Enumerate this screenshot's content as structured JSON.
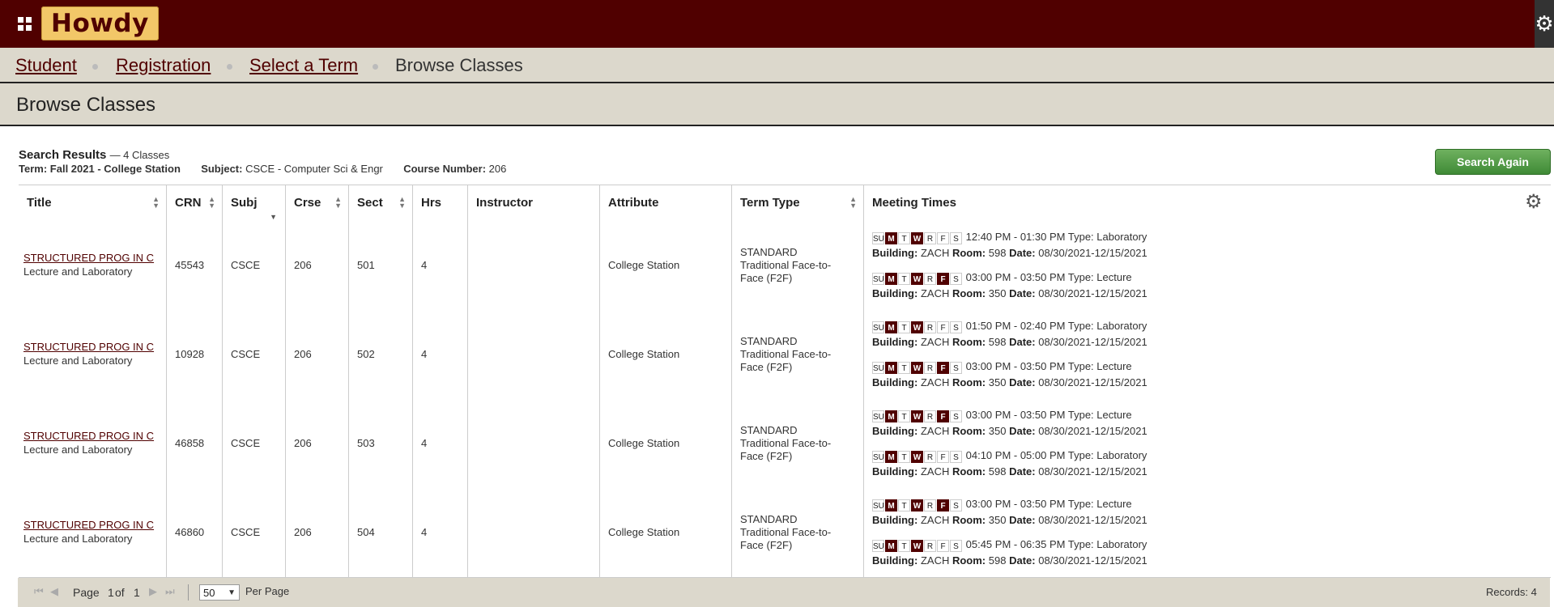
{
  "header": {
    "logo": "Howdy",
    "apps_icon": "apps-grid-icon",
    "settings_icon": "gear-icon"
  },
  "breadcrumb": [
    "Student",
    "Registration",
    "Select a Term",
    "Browse Classes"
  ],
  "page_title": "Browse Classes",
  "search": {
    "label": "Search Results",
    "count": "— 4 Classes",
    "term_label": "Term:",
    "term_value": "Fall 2021 - College Station",
    "subject_label": "Subject:",
    "subject_value": "CSCE - Computer Sci & Engr",
    "course_label": "Course Number:",
    "course_value": "206",
    "search_again": "Search Again"
  },
  "columns": [
    "Title",
    "CRN",
    "Subj",
    "Crse",
    "Sect",
    "Hrs",
    "Instructor",
    "Attribute",
    "Term Type",
    "Meeting Times"
  ],
  "rows": [
    {
      "title": "STRUCTURED PROG IN C",
      "subtitle": "Lecture and Laboratory",
      "crn": "45543",
      "subj": "CSCE",
      "crse": "206",
      "sect": "501",
      "hrs": "4",
      "instructor": "",
      "attribute": "College Station",
      "term_type": "STANDARD Traditional Face-to-Face (F2F)",
      "meetings": [
        {
          "days": [
            false,
            true,
            false,
            true,
            false,
            false,
            false
          ],
          "time": "12:40 PM - 01:30 PM",
          "type": "Laboratory",
          "building": "ZACH",
          "room": "598",
          "date": "08/30/2021-12/15/2021"
        },
        {
          "days": [
            false,
            true,
            false,
            true,
            false,
            true,
            false
          ],
          "time": "03:00 PM - 03:50 PM",
          "type": "Lecture",
          "building": "ZACH",
          "room": "350",
          "date": "08/30/2021-12/15/2021"
        }
      ]
    },
    {
      "title": "STRUCTURED PROG IN C",
      "subtitle": "Lecture and Laboratory",
      "crn": "10928",
      "subj": "CSCE",
      "crse": "206",
      "sect": "502",
      "hrs": "4",
      "instructor": "",
      "attribute": "College Station",
      "term_type": "STANDARD Traditional Face-to-Face (F2F)",
      "meetings": [
        {
          "days": [
            false,
            true,
            false,
            true,
            false,
            false,
            false
          ],
          "time": "01:50 PM - 02:40 PM",
          "type": "Laboratory",
          "building": "ZACH",
          "room": "598",
          "date": "08/30/2021-12/15/2021"
        },
        {
          "days": [
            false,
            true,
            false,
            true,
            false,
            true,
            false
          ],
          "time": "03:00 PM - 03:50 PM",
          "type": "Lecture",
          "building": "ZACH",
          "room": "350",
          "date": "08/30/2021-12/15/2021"
        }
      ]
    },
    {
      "title": "STRUCTURED PROG IN C",
      "subtitle": "Lecture and Laboratory",
      "crn": "46858",
      "subj": "CSCE",
      "crse": "206",
      "sect": "503",
      "hrs": "4",
      "instructor": "",
      "attribute": "College Station",
      "term_type": "STANDARD Traditional Face-to-Face (F2F)",
      "meetings": [
        {
          "days": [
            false,
            true,
            false,
            true,
            false,
            true,
            false
          ],
          "time": "03:00 PM - 03:50 PM",
          "type": "Lecture",
          "building": "ZACH",
          "room": "350",
          "date": "08/30/2021-12/15/2021"
        },
        {
          "days": [
            false,
            true,
            false,
            true,
            false,
            false,
            false
          ],
          "time": "04:10 PM - 05:00 PM",
          "type": "Laboratory",
          "building": "ZACH",
          "room": "598",
          "date": "08/30/2021-12/15/2021"
        }
      ]
    },
    {
      "title": "STRUCTURED PROG IN C",
      "subtitle": "Lecture and Laboratory",
      "crn": "46860",
      "subj": "CSCE",
      "crse": "206",
      "sect": "504",
      "hrs": "4",
      "instructor": "",
      "attribute": "College Station",
      "term_type": "STANDARD Traditional Face-to-Face (F2F)",
      "meetings": [
        {
          "days": [
            false,
            true,
            false,
            true,
            false,
            true,
            false
          ],
          "time": "03:00 PM - 03:50 PM",
          "type": "Lecture",
          "building": "ZACH",
          "room": "350",
          "date": "08/30/2021-12/15/2021"
        },
        {
          "days": [
            false,
            true,
            false,
            true,
            false,
            false,
            false
          ],
          "time": "05:45 PM - 06:35 PM",
          "type": "Laboratory",
          "building": "ZACH",
          "room": "598",
          "date": "08/30/2021-12/15/2021"
        }
      ]
    }
  ],
  "day_letters": [
    "SU",
    "M",
    "T",
    "W",
    "R",
    "F",
    "S"
  ],
  "meeting_labels": {
    "type": "Type:",
    "building": "Building:",
    "room": "Room:",
    "date": "Date:"
  },
  "footer": {
    "page_label": "Page",
    "page_current": "1",
    "of_label": "of",
    "page_total": "1",
    "per_page_value": "50",
    "per_page_label": "Per Page",
    "records": "Records: 4"
  },
  "colors": {
    "maroon": "#500000",
    "tan": "#dcd8cc",
    "green": "#4a9a3f"
  }
}
